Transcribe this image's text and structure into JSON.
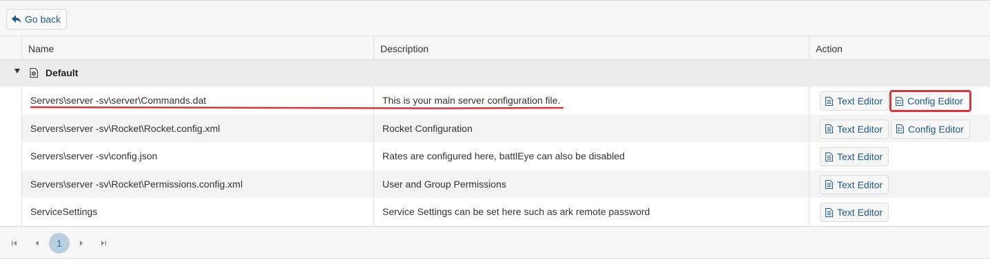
{
  "toolbar": {
    "go_back_label": "Go back"
  },
  "grid": {
    "columns": {
      "name": "Name",
      "description": "Description",
      "action": "Action"
    },
    "group": {
      "label": "Default"
    },
    "rows": [
      {
        "name": "Servers\\server -sv\\server\\Commands.dat",
        "description": "This is your main server configuration file.",
        "text_editor": "Text Editor",
        "config_editor": "Config Editor"
      },
      {
        "name": "Servers\\server -sv\\Rocket\\Rocket.config.xml",
        "description": "Rocket Configuration",
        "text_editor": "Text Editor",
        "config_editor": "Config Editor"
      },
      {
        "name": "Servers\\server -sv\\config.json",
        "description": "Rates are configured here, battlEye can also be disabled",
        "text_editor": "Text Editor"
      },
      {
        "name": "Servers\\server -sv\\Rocket\\Permissions.config.xml",
        "description": "User and Group Permissions",
        "text_editor": "Text Editor"
      },
      {
        "name": "ServiceSettings",
        "description": "Service Settings can be set here such as ark remote password",
        "text_editor": "Text Editor"
      }
    ]
  },
  "pager": {
    "current_page": "1"
  },
  "colors": {
    "accent": "#1e5b8a",
    "highlight": "#d9343a",
    "page_active": "#b8cfe0"
  }
}
